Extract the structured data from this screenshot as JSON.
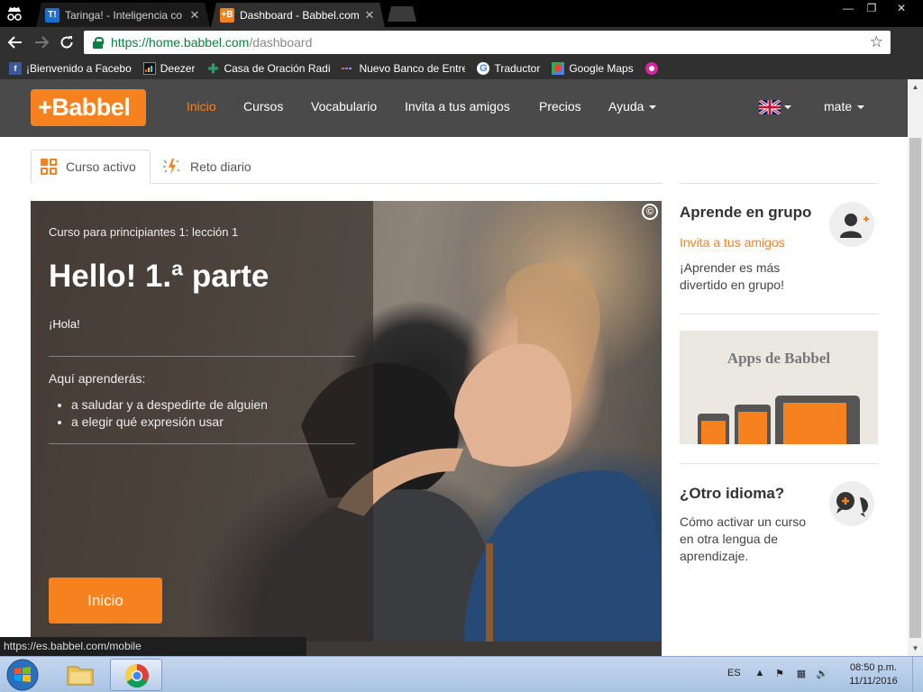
{
  "browser": {
    "tabs": [
      {
        "favicon": "T!",
        "title": "Taringa! - Inteligencia co",
        "close": "✕"
      },
      {
        "favicon": "+B",
        "title": "Dashboard - Babbel.com",
        "close": "✕"
      }
    ],
    "window_controls": {
      "minimize": "—",
      "restore": "❐",
      "close": "✕"
    },
    "url_host": "https://home.babbel.com",
    "url_path": "/dashboard",
    "bookmarks": [
      {
        "icon": "facebook-icon",
        "label": "¡Bienvenido a Facebo",
        "color": "#3b5998"
      },
      {
        "icon": "deezer-icon",
        "label": "Deezer",
        "color": "#222222"
      },
      {
        "icon": "church-icon",
        "label": "Casa de Oración Radi",
        "color": "#27a06b"
      },
      {
        "icon": "bank-icon",
        "label": "Nuevo Banco de Entre",
        "color": "#6b4fa0"
      },
      {
        "icon": "google-icon",
        "label": "Traductor",
        "color": "#4285f4"
      },
      {
        "icon": "maps-icon",
        "label": "Google Maps",
        "color": "#34a853"
      }
    ],
    "status_url": "https://es.babbel.com/mobile"
  },
  "header": {
    "logo": "+Babbel",
    "nav": [
      {
        "label": "Inicio",
        "active": true
      },
      {
        "label": "Cursos"
      },
      {
        "label": "Vocabulario"
      },
      {
        "label": "Invita a tus amigos"
      },
      {
        "label": "Precios"
      },
      {
        "label": "Ayuda"
      }
    ],
    "user": "mate"
  },
  "content_tabs": {
    "active": "Curso activo",
    "daily": "Reto diario"
  },
  "hero": {
    "copyright": "©",
    "subtitle": "Curso para principiantes 1: lección 1",
    "title": "Hello! 1.ª parte",
    "hola": "¡Hola!",
    "learn_label": "Aquí aprenderás:",
    "learn_items": [
      "a saludar y a despedirte de alguien",
      "a elegir qué expresión usar"
    ],
    "button": "Inicio"
  },
  "sidebar": {
    "group": {
      "title": "Aprende en grupo",
      "link": "Invita a tus amigos",
      "text_1": "¡Aprender es más",
      "text_2": "divertido en grupo!"
    },
    "apps": {
      "title": "Apps de Babbel"
    },
    "language": {
      "title": "¿Otro idioma?",
      "text_1": "Cómo activar un curso",
      "text_2": "en otra lengua de",
      "text_3": "aprendizaje."
    }
  },
  "taskbar": {
    "lang": "ES",
    "time": "08:50 p.m.",
    "date": "11/11/2016"
  },
  "colors": {
    "brand_orange": "#f5821f",
    "header_gray": "#4a4a4a",
    "chrome_dark": "#303030"
  }
}
